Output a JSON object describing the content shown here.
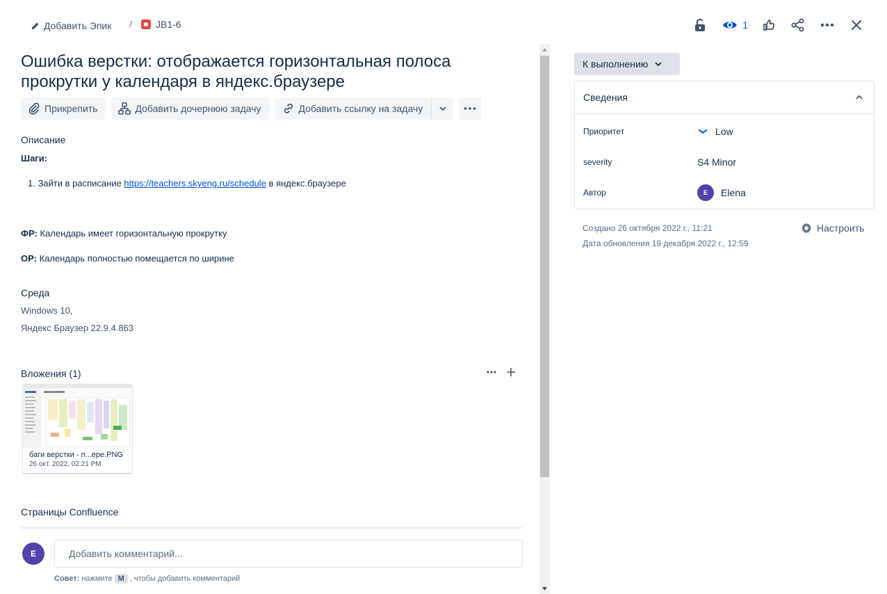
{
  "breadcrumb": {
    "add_epic_label": "Добавить Эпик",
    "separator": "/",
    "issue_key": "JB1-6"
  },
  "top_actions": {
    "icons": [
      "lock-icon",
      "eye-icon",
      "thumbs-up-icon",
      "share-icon",
      "more-icon",
      "close-icon"
    ],
    "watchers_count": "1"
  },
  "issue": {
    "title": "Ошибка верстки: отображается горизонтальная полоса прокрутки у календаря в яндекс.браузере"
  },
  "toolbar": {
    "attach_label": "Прикрепить",
    "add_child_label": "Добавить дочернюю задачу",
    "add_link_label": "Добавить ссылку на задачу"
  },
  "description": {
    "heading": "Описание",
    "steps_heading": "Шаги:",
    "step_1_prefix": "1. Зайти в расписание ",
    "step_1_link": "https://teachers.skyeng.ru/schedule",
    "step_1_suffix": " в яндекс.браузере",
    "actual_label": "ФР:",
    "actual_text": " Календарь имеет горизонтальную прокрутку",
    "expected_label": "ОР:",
    "expected_text": " Календарь полностью помещается по ширине"
  },
  "environment": {
    "heading": "Среда",
    "line_1": "Windows 10,",
    "line_2": "Яндекс Браузер 22.9.4.863"
  },
  "attachments": {
    "heading": "Вложения (1)",
    "items": [
      {
        "name": "баги верстки - п...ере.PNG",
        "date": "26 окт. 2022, 02:21 PM"
      }
    ]
  },
  "confluence": {
    "heading": "Страницы Confluence"
  },
  "comment": {
    "avatar_initial": "E",
    "placeholder": "Добавить комментарий...",
    "tip_label": "Совет:",
    "tip_before": " нажмите",
    "tip_key": "M",
    "tip_after": ", чтобы добавить комментарий"
  },
  "status": {
    "label": "К выполнению"
  },
  "details": {
    "heading": "Сведения",
    "priority_label": "Приоритет",
    "priority_value": "Low",
    "severity_label": "severity",
    "severity_value": "S4 Minor",
    "author_label": "Автор",
    "author_initial": "E",
    "author_name": "Elena"
  },
  "meta": {
    "created": "Создано 26 октября 2022 г., 11:21",
    "updated": "Дата обновления 19 декабря 2022 г., 12:59",
    "configure_label": "Настроить"
  },
  "colors": {
    "accent": "#0052cc",
    "bug": "#e5493a",
    "avatar": "#5243aa",
    "text": "#172b4d"
  }
}
